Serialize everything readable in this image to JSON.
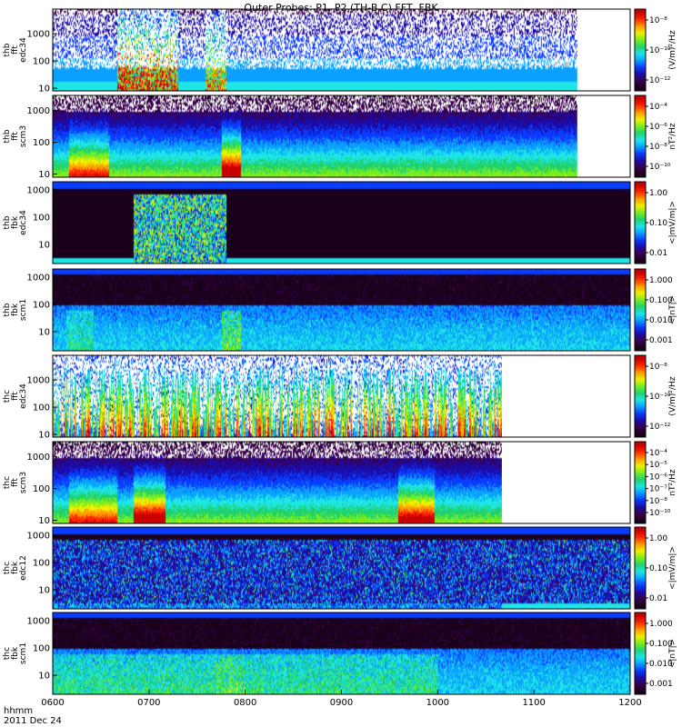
{
  "title": "Outer Probes: P1, P2 (TH-B,C) FFT, FBK",
  "footer": {
    "line1": "hhmm",
    "line2": "2011 Dec 24"
  },
  "colors": {
    "colormap": [
      "#1a001a",
      "#3a0050",
      "#1b0ca8",
      "#0a3cff",
      "#0aa0ff",
      "#1ee6e6",
      "#20d26e",
      "#78ee20",
      "#f0f000",
      "#ff9a00",
      "#ff2a00",
      "#c80000"
    ],
    "background": "#ffffff",
    "no_data": "#ffffff"
  },
  "chart_data": [
    {
      "type": "heatmap",
      "probe": "thb",
      "instrument": "fft",
      "channel": "edc34",
      "label_lines": [
        "thb",
        "fft",
        "edc34"
      ],
      "x_range": [
        "0600",
        "1200"
      ],
      "ylim": [
        8,
        8000
      ],
      "y_scale": "log",
      "y_ticks": [
        "10",
        "100",
        "1000"
      ],
      "data_end": "1127",
      "colorbar": {
        "ticks": [
          "10⁻⁸",
          "10⁻¹⁰",
          "10⁻¹²"
        ],
        "label": "(V/m)²/Hz"
      },
      "profile": "sparse",
      "events": [
        [
          "0640",
          "0718",
          0.85
        ],
        [
          "0735",
          "0748",
          0.6
        ]
      ]
    },
    {
      "type": "heatmap",
      "probe": "thb",
      "instrument": "fft",
      "channel": "scm3",
      "label_lines": [
        "thb",
        "fft",
        "scm3"
      ],
      "x_range": [
        "0600",
        "1200"
      ],
      "ylim": [
        8,
        3000
      ],
      "y_scale": "log",
      "y_ticks": [
        "10",
        "100",
        "1000"
      ],
      "data_end": "1127",
      "colorbar": {
        "ticks": [
          "10⁻⁴",
          "10⁻⁶",
          "10⁻⁸",
          "10⁻¹⁰"
        ],
        "label": "nT²/Hz"
      },
      "profile": "scm",
      "events": [
        [
          "0610",
          "0635",
          0.5
        ],
        [
          "0745",
          "0757",
          0.85
        ]
      ]
    },
    {
      "type": "heatmap",
      "probe": "thb",
      "instrument": "fbk",
      "channel": "edc34",
      "label_lines": [
        "thb",
        "fbk",
        "edc34"
      ],
      "x_range": [
        "0600",
        "1200"
      ],
      "ylim": [
        2,
        2000
      ],
      "y_scale": "log",
      "y_ticks": [
        "10",
        "100",
        "1000"
      ],
      "data_end": "1200",
      "colorbar": {
        "ticks": [
          "1.00",
          "0.10",
          "0.01"
        ],
        "label": "<|mV/m|>"
      },
      "profile": "fbk_e",
      "events": [
        [
          "0650",
          "0748",
          0.9
        ]
      ]
    },
    {
      "type": "heatmap",
      "probe": "thb",
      "instrument": "fbk",
      "channel": "scm1",
      "label_lines": [
        "thb",
        "fbk",
        "scm1"
      ],
      "x_range": [
        "0600",
        "1200"
      ],
      "ylim": [
        2,
        2000
      ],
      "y_scale": "log",
      "y_ticks": [
        "10",
        "100",
        "1000"
      ],
      "data_end": "1200",
      "colorbar": {
        "ticks": [
          "1.000",
          "0.100",
          "0.010",
          "0.001"
        ],
        "label": "<|nT|>"
      },
      "profile": "fbk_b",
      "events": [
        [
          "0745",
          "0757",
          0.8
        ],
        [
          "0608",
          "0625",
          0.4
        ]
      ]
    },
    {
      "type": "heatmap",
      "probe": "thc",
      "instrument": "fft",
      "channel": "edc34",
      "label_lines": [
        "thc",
        "fft",
        "edc34"
      ],
      "x_range": [
        "0600",
        "1200"
      ],
      "ylim": [
        8,
        8000
      ],
      "y_scale": "log",
      "y_ticks": [
        "10",
        "100",
        "1000"
      ],
      "data_end": "1040",
      "colorbar": {
        "ticks": [
          "10⁻⁸",
          "10⁻¹⁰",
          "10⁻¹²"
        ],
        "label": "(V/m)²/Hz"
      },
      "profile": "bursty",
      "events": [
        [
          "0600",
          "1040",
          0.8
        ]
      ]
    },
    {
      "type": "heatmap",
      "probe": "thc",
      "instrument": "fft",
      "channel": "scm3",
      "label_lines": [
        "thc",
        "fft",
        "scm3"
      ],
      "x_range": [
        "0600",
        "1200"
      ],
      "ylim": [
        8,
        3000
      ],
      "y_scale": "log",
      "y_ticks": [
        "10",
        "100",
        "1000"
      ],
      "data_end": "1040",
      "colorbar": {
        "ticks": [
          "10⁻⁴",
          "10⁻⁵",
          "10⁻⁶",
          "10⁻⁷",
          "10⁻⁸",
          "10⁻¹⁰"
        ],
        "label": "nT²/Hz"
      },
      "profile": "scm",
      "events": [
        [
          "0650",
          "0710",
          0.8
        ],
        [
          "0935",
          "0958",
          0.7
        ],
        [
          "0610",
          "0640",
          0.5
        ]
      ]
    },
    {
      "type": "heatmap",
      "probe": "thc",
      "instrument": "fbk",
      "channel": "edc12",
      "label_lines": [
        "thc",
        "fbk",
        "edc12"
      ],
      "x_range": [
        "0600",
        "1200"
      ],
      "ylim": [
        2,
        2000
      ],
      "y_scale": "log",
      "y_ticks": [
        "10",
        "100",
        "1000"
      ],
      "data_end": "1200",
      "colorbar": {
        "ticks": [
          "1.00",
          "0.10",
          "0.01"
        ],
        "label": "<|mV/m|>"
      },
      "profile": "fbk_e2",
      "events": [
        [
          "0600",
          "1040",
          0.5
        ]
      ]
    },
    {
      "type": "heatmap",
      "probe": "thc",
      "instrument": "fbk",
      "channel": "scm1",
      "label_lines": [
        "thc",
        "fbk",
        "scm1"
      ],
      "x_range": [
        "0600",
        "1200"
      ],
      "ylim": [
        2,
        2000
      ],
      "y_scale": "log",
      "y_ticks": [
        "10",
        "100",
        "1000"
      ],
      "data_end": "1200",
      "colorbar": {
        "ticks": [
          "1.000",
          "0.100",
          "0.010",
          "0.001"
        ],
        "label": "<|nT|>"
      },
      "profile": "fbk_b2",
      "events": [
        [
          "0600",
          "1000",
          0.5
        ],
        [
          "0742",
          "0760",
          0.7
        ]
      ]
    }
  ],
  "x_axis": {
    "ticks": [
      "0600",
      "0700",
      "0800",
      "0900",
      "1000",
      "1100",
      "1200"
    ]
  }
}
